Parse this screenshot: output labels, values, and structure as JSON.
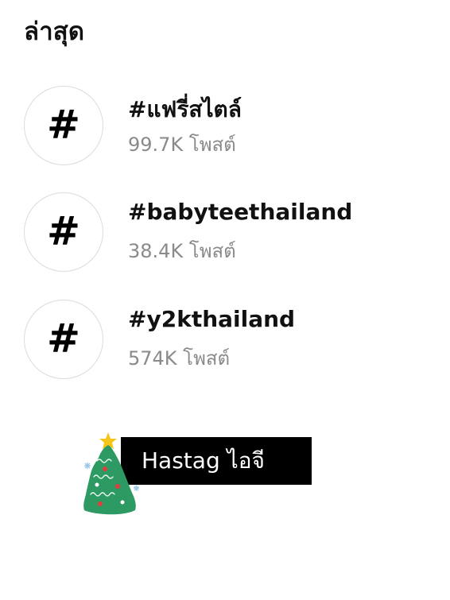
{
  "section": {
    "title": "ล่าสุด"
  },
  "hashtags": [
    {
      "icon": "hashtag-icon",
      "symbol": "#",
      "name": "#แฟรี่สไตล์",
      "count": "99.7K โพสต์"
    },
    {
      "icon": "hashtag-icon",
      "symbol": "#",
      "name": "#babyteethailand",
      "count": "38.4K โพสต์"
    },
    {
      "icon": "hashtag-icon",
      "symbol": "#",
      "name": "#y2kthailand",
      "count": "574K โพสต์"
    }
  ],
  "caption": {
    "text": "Hastag ไอจี"
  },
  "sticker": {
    "icon": "christmas-tree-icon"
  },
  "colors": {
    "text_primary": "#111111",
    "text_secondary": "#8a8a8a",
    "circle_border": "#dbdbdb",
    "caption_bg": "#000000",
    "caption_text": "#ffffff",
    "tree_green": "#2e9a63",
    "star": "#f5c518"
  }
}
